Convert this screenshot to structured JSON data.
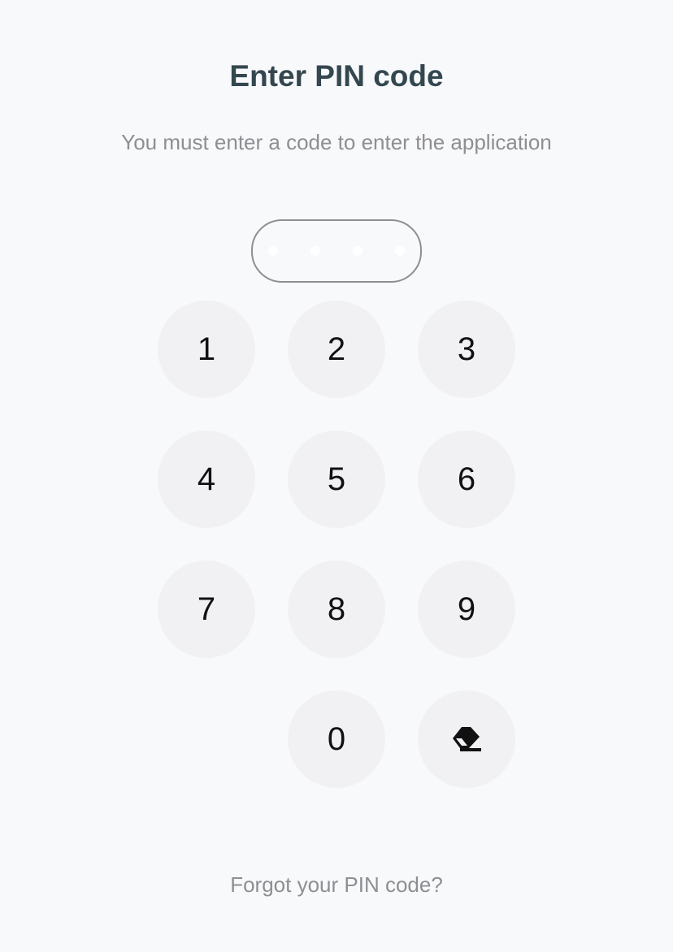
{
  "header": {
    "title": "Enter PIN code",
    "subtitle": "You must enter a code to enter the application"
  },
  "pin": {
    "length": 4,
    "entered": 0
  },
  "keypad": {
    "keys": [
      "1",
      "2",
      "3",
      "4",
      "5",
      "6",
      "7",
      "8",
      "9",
      "0"
    ],
    "backspace_icon": "backspace-eraser-icon"
  },
  "footer": {
    "forgot_label": "Forgot your PIN code?"
  },
  "colors": {
    "background": "#f8f9fb",
    "title": "#34474f",
    "muted_text": "#8e8e93",
    "key_background": "#f1f1f4"
  }
}
